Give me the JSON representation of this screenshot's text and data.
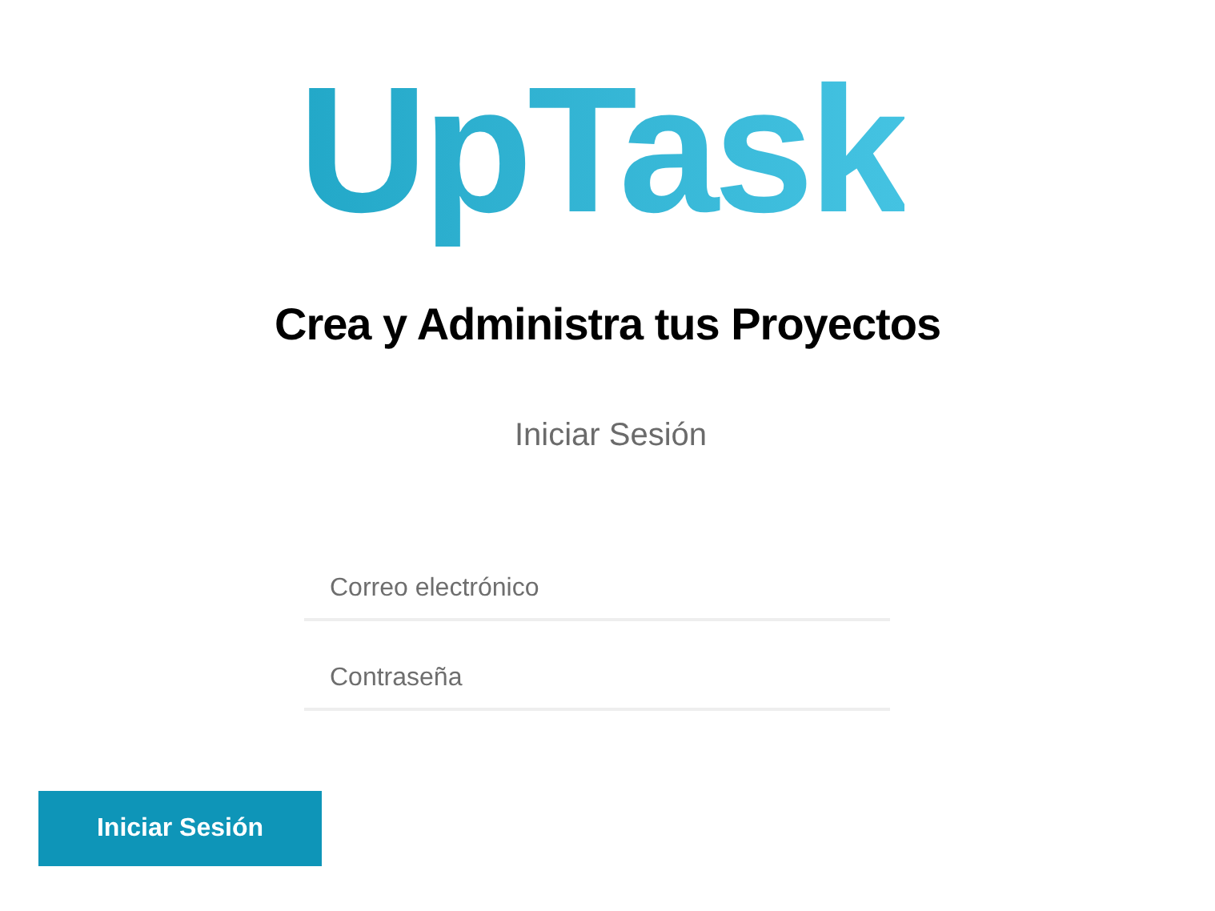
{
  "logo": "UpTask",
  "tagline": "Crea y Administra tus Proyectos",
  "form": {
    "heading": "Iniciar Sesión",
    "fields": [
      {
        "placeholder": "Correo electrónico"
      },
      {
        "placeholder": "Contraseña"
      }
    ],
    "submit": "Iniciar Sesión"
  }
}
